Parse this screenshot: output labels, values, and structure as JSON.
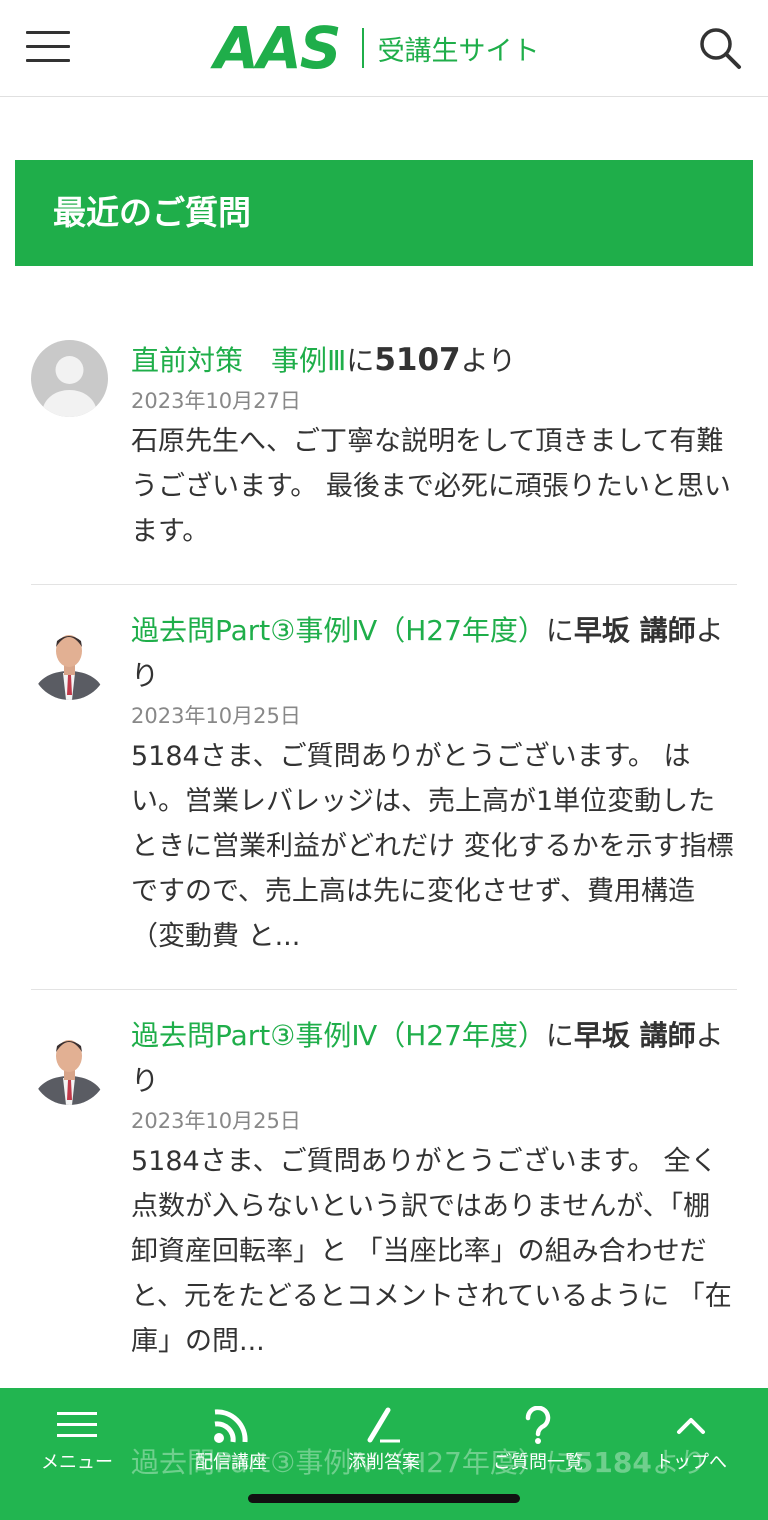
{
  "header": {
    "logo": "AAS",
    "subtitle": "受講生サイト"
  },
  "section": {
    "title": "最近のご質問"
  },
  "questions": [
    {
      "course": "直前対策　事例Ⅲ",
      "connector": "に",
      "author": "5107",
      "suffix": "より",
      "date": "2023年10月27日",
      "body": "石原先生へ、ご丁寧な説明をして頂きまして有難うございます。 最後まで必死に頑張りたいと思います。"
    },
    {
      "course": "過去問Part③事例Ⅳ（H27年度）",
      "connector": "に",
      "author": "早坂 講師",
      "suffix": "より",
      "date": "2023年10月25日",
      "body": "5184さま、ご質問ありがとうございます。 はい。営業レバレッジは、売上高が1単位変動したときに営業利益がどれだけ 変化するかを示す指標ですので、売上高は先に変化させず、費用構造（変動費 と..."
    },
    {
      "course": "過去問Part③事例Ⅳ（H27年度）",
      "connector": "に",
      "author": "早坂 講師",
      "suffix": "より",
      "date": "2023年10月25日",
      "body": "5184さま、ご質問ありがとうございます。 全く点数が入らないという訳ではありませんが、「棚卸資産回転率」と 「当座比率」の組み合わせだと、元をたどるとコメントされているように 「在庫」の問..."
    }
  ],
  "ghost_row": {
    "course": "過去問Part③事例Ⅳ（H27年度）",
    "connector": "に",
    "author": "5184",
    "suffix": "より"
  },
  "nav": {
    "menu": "メニュー",
    "stream": "配信講座",
    "correction": "添削答案",
    "questions": "ご質問一覧",
    "top": "トップへ"
  },
  "colors": {
    "brand_green": "#1fae4a",
    "nav_green": "#22b550"
  }
}
